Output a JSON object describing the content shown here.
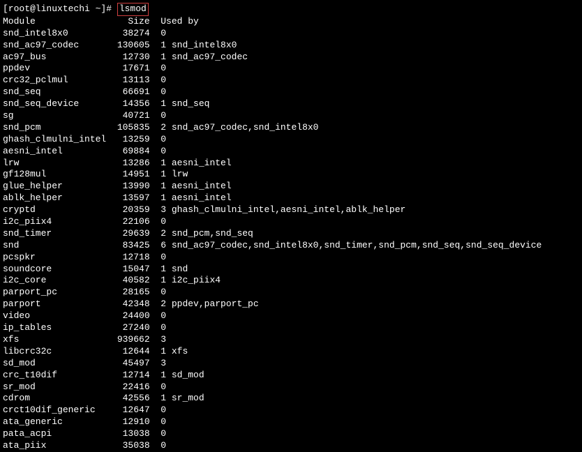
{
  "prompt": "[root@linuxtechi ~]# ",
  "command": "lsmod",
  "headers": {
    "module": "Module",
    "size": "Size",
    "used_by": "Used by"
  },
  "modules": [
    {
      "name": "snd_intel8x0",
      "size": "38274",
      "count": "0",
      "by": ""
    },
    {
      "name": "snd_ac97_codec",
      "size": "130605",
      "count": "1",
      "by": "snd_intel8x0"
    },
    {
      "name": "ac97_bus",
      "size": "12730",
      "count": "1",
      "by": "snd_ac97_codec"
    },
    {
      "name": "ppdev",
      "size": "17671",
      "count": "0",
      "by": ""
    },
    {
      "name": "crc32_pclmul",
      "size": "13113",
      "count": "0",
      "by": ""
    },
    {
      "name": "snd_seq",
      "size": "66691",
      "count": "0",
      "by": ""
    },
    {
      "name": "snd_seq_device",
      "size": "14356",
      "count": "1",
      "by": "snd_seq"
    },
    {
      "name": "sg",
      "size": "40721",
      "count": "0",
      "by": ""
    },
    {
      "name": "snd_pcm",
      "size": "105835",
      "count": "2",
      "by": "snd_ac97_codec,snd_intel8x0"
    },
    {
      "name": "ghash_clmulni_intel",
      "size": "13259",
      "count": "0",
      "by": ""
    },
    {
      "name": "aesni_intel",
      "size": "69884",
      "count": "0",
      "by": ""
    },
    {
      "name": "lrw",
      "size": "13286",
      "count": "1",
      "by": "aesni_intel"
    },
    {
      "name": "gf128mul",
      "size": "14951",
      "count": "1",
      "by": "lrw"
    },
    {
      "name": "glue_helper",
      "size": "13990",
      "count": "1",
      "by": "aesni_intel"
    },
    {
      "name": "ablk_helper",
      "size": "13597",
      "count": "1",
      "by": "aesni_intel"
    },
    {
      "name": "cryptd",
      "size": "20359",
      "count": "3",
      "by": "ghash_clmulni_intel,aesni_intel,ablk_helper"
    },
    {
      "name": "i2c_piix4",
      "size": "22106",
      "count": "0",
      "by": ""
    },
    {
      "name": "snd_timer",
      "size": "29639",
      "count": "2",
      "by": "snd_pcm,snd_seq"
    },
    {
      "name": "snd",
      "size": "83425",
      "count": "6",
      "by": "snd_ac97_codec,snd_intel8x0,snd_timer,snd_pcm,snd_seq,snd_seq_device"
    },
    {
      "name": "pcspkr",
      "size": "12718",
      "count": "0",
      "by": ""
    },
    {
      "name": "soundcore",
      "size": "15047",
      "count": "1",
      "by": "snd"
    },
    {
      "name": "i2c_core",
      "size": "40582",
      "count": "1",
      "by": "i2c_piix4"
    },
    {
      "name": "parport_pc",
      "size": "28165",
      "count": "0",
      "by": ""
    },
    {
      "name": "parport",
      "size": "42348",
      "count": "2",
      "by": "ppdev,parport_pc"
    },
    {
      "name": "video",
      "size": "24400",
      "count": "0",
      "by": ""
    },
    {
      "name": "ip_tables",
      "size": "27240",
      "count": "0",
      "by": ""
    },
    {
      "name": "xfs",
      "size": "939662",
      "count": "3",
      "by": ""
    },
    {
      "name": "libcrc32c",
      "size": "12644",
      "count": "1",
      "by": "xfs"
    },
    {
      "name": "sd_mod",
      "size": "45497",
      "count": "3",
      "by": ""
    },
    {
      "name": "crc_t10dif",
      "size": "12714",
      "count": "1",
      "by": "sd_mod"
    },
    {
      "name": "sr_mod",
      "size": "22416",
      "count": "0",
      "by": ""
    },
    {
      "name": "cdrom",
      "size": "42556",
      "count": "1",
      "by": "sr_mod"
    },
    {
      "name": "crct10dif_generic",
      "size": "12647",
      "count": "0",
      "by": ""
    },
    {
      "name": "ata_generic",
      "size": "12910",
      "count": "0",
      "by": ""
    },
    {
      "name": "pata_acpi",
      "size": "13038",
      "count": "0",
      "by": ""
    },
    {
      "name": "ata_piix",
      "size": "35038",
      "count": "0",
      "by": ""
    }
  ]
}
